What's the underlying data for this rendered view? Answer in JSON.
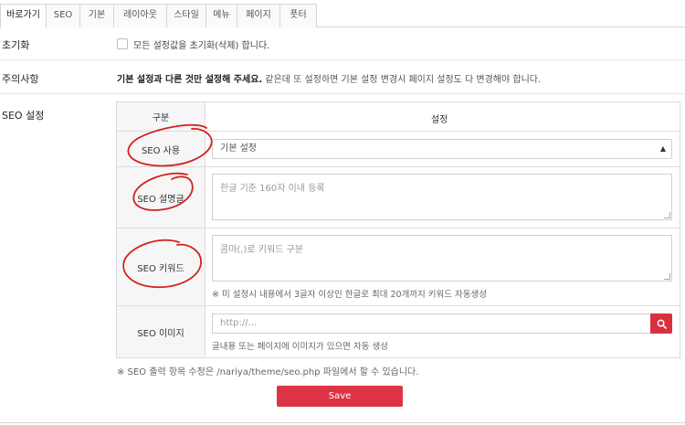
{
  "tabs": [
    {
      "label": "바로가기",
      "active": true
    },
    {
      "label": "SEO",
      "active": false
    },
    {
      "label": "기본",
      "active": false
    },
    {
      "label": "레이아웃",
      "active": false
    },
    {
      "label": "스타일",
      "active": false
    },
    {
      "label": "메뉴",
      "active": false
    },
    {
      "label": "페이지",
      "active": false
    },
    {
      "label": "풋터",
      "active": false
    }
  ],
  "reset": {
    "label": "초기화",
    "checkbox_label": "모든 설정값을 초기화(삭제) 합니다.",
    "checked": false
  },
  "notice": {
    "label": "주의사항",
    "bold": "기본 설정과 다른 것만 설정해 주세요.",
    "text": " 같은데 또 설정하면 기본 설정 변경시 페이지 설정도 다 변경해야 합니다."
  },
  "seo": {
    "label": "SEO 설정",
    "col_category": "구분",
    "col_setting": "설정",
    "use_label": "SEO 사용",
    "use_value": "기본 설정",
    "desc_label": "SEO 설명글",
    "desc_placeholder": "한글 기준 160자 이내 등록",
    "keyword_label": "SEO 키워드",
    "keyword_placeholder": "콤마(,)로 키워드 구분",
    "keyword_hint": "※ 미 설정시 내용에서 3글자 이상인 한글로 최대 20개까지 키워드 자동생성",
    "image_label": "SEO 이미지",
    "image_placeholder": "http://...",
    "image_hint": "글내용 또는 페이지에 이미지가 있으면 자동 생성",
    "footnote": "※ SEO 출력 항목 수정은 /nariya/theme/seo.php 파일에서 할 수 있습니다."
  },
  "save_label": "Save",
  "colors": {
    "accent": "#dd3445",
    "annotation": "#d42020"
  },
  "icons": {
    "select_arrow": "sort-arrows-icon",
    "search": "search-icon"
  }
}
